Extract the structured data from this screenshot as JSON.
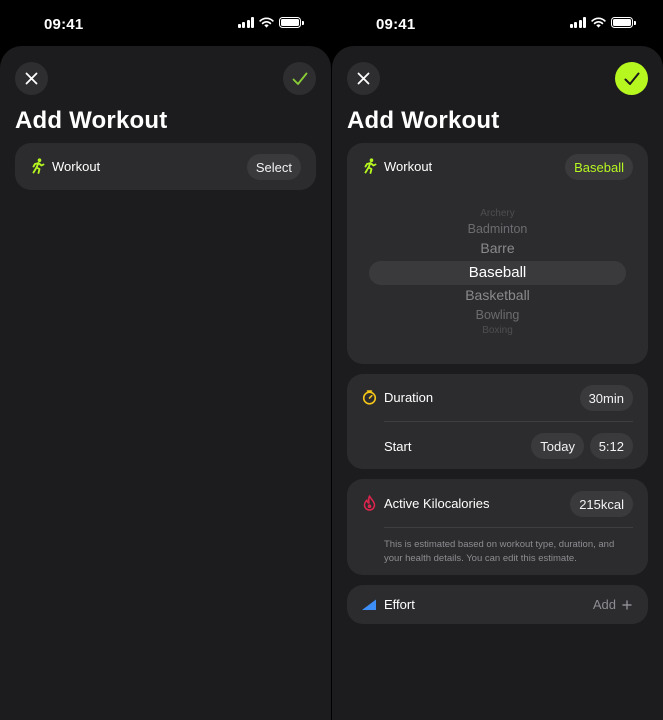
{
  "status_bar": {
    "time": "09:41"
  },
  "left_screen": {
    "title": "Add Workout",
    "workout": {
      "label": "Workout",
      "button": "Select"
    }
  },
  "right_screen": {
    "title": "Add Workout",
    "workout": {
      "label": "Workout",
      "selected": "Baseball",
      "picker_options": [
        "Archery",
        "Badminton",
        "Barre",
        "Baseball",
        "Basketball",
        "Bowling",
        "Boxing"
      ]
    },
    "duration": {
      "label": "Duration",
      "value": "30min"
    },
    "start": {
      "label": "Start",
      "date": "Today",
      "time": "5:12"
    },
    "calories": {
      "label": "Active Kilocalories",
      "value": "215kcal",
      "note": "This is estimated based on workout type, duration, and your health details. You can edit this estimate."
    },
    "effort": {
      "label": "Effort",
      "action": "Add"
    }
  },
  "colors": {
    "accent": "#b7f720",
    "duration_icon": "#f5c518",
    "calories_icon": "#e0244d",
    "effort_icon": "#3d8ef7",
    "card": "#2c2c2e",
    "sheet": "#1c1c1e"
  },
  "icons": {
    "close": "close-icon",
    "confirm": "checkmark-icon",
    "workout": "running-figure-icon",
    "duration": "timer-icon",
    "calories": "flame-icon",
    "effort": "effort-wedge-icon",
    "add": "plus-icon"
  }
}
